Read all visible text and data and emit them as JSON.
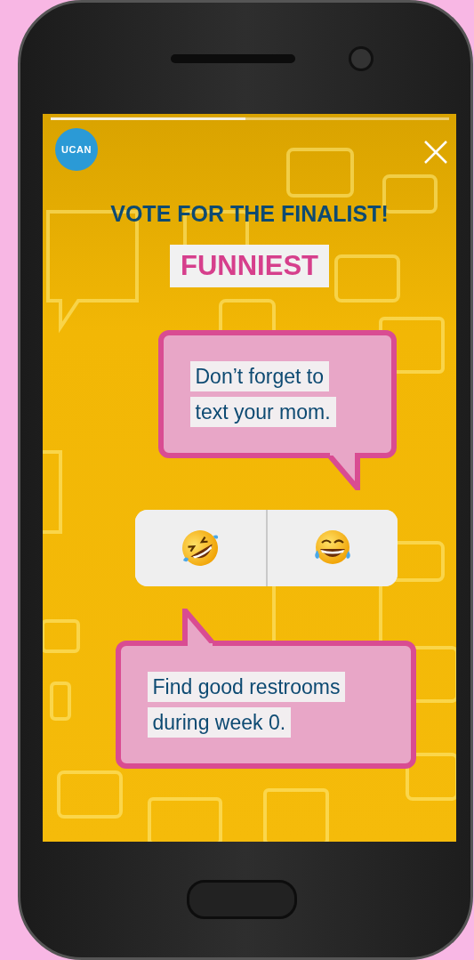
{
  "story_progress": {
    "level": 0.49
  },
  "logo": {
    "text": "UCAN"
  },
  "title": "VOTE FOR THE FINALIST!",
  "category": "FUNNIEST",
  "bubbles": [
    {
      "kind": "tail_bottom",
      "text": "Don’t forget to text your mom."
    },
    {
      "kind": "tail_top",
      "text": "Find good restrooms during week 0."
    }
  ],
  "poll": {
    "options": [
      {
        "kind": "tilted-laughing"
      },
      {
        "kind": "tears-laughing"
      }
    ]
  }
}
